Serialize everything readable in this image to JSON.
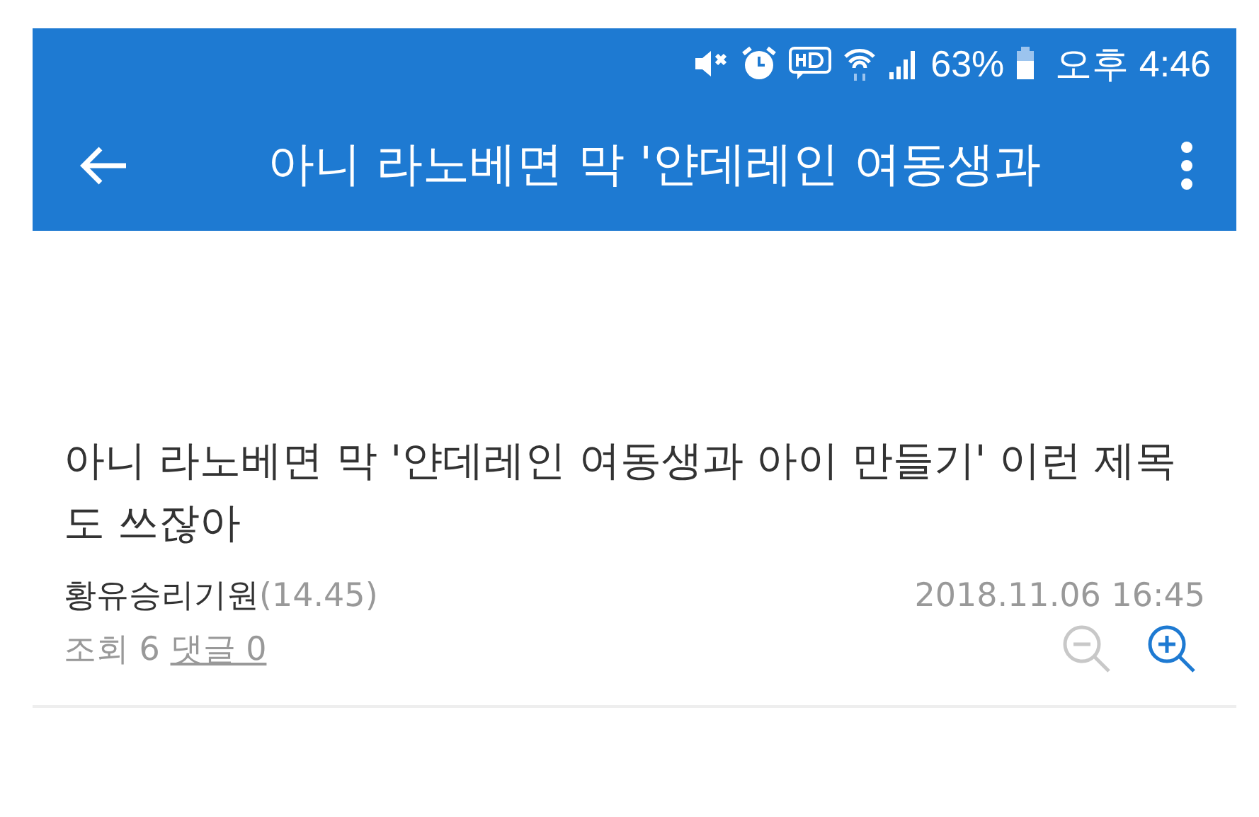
{
  "status_bar": {
    "battery_percent": "63%",
    "time": "오후 4:46"
  },
  "toolbar": {
    "title": "아니 라노베면 막 '얀데레인 여동생과"
  },
  "post": {
    "title": "아니 라노베면 막 '얀데레인 여동생과 아이 만들기' 이런 제목도 쓰잖아",
    "author": "황유승리기원",
    "author_score": "(14.45)",
    "date": "2018.11.06 16:45",
    "views": "조회 6",
    "comments": "댓글 0"
  },
  "zoom_controls": [
    {
      "kind": "zoom-out",
      "disabled": true
    },
    {
      "kind": "zoom-in",
      "disabled": false
    }
  ]
}
